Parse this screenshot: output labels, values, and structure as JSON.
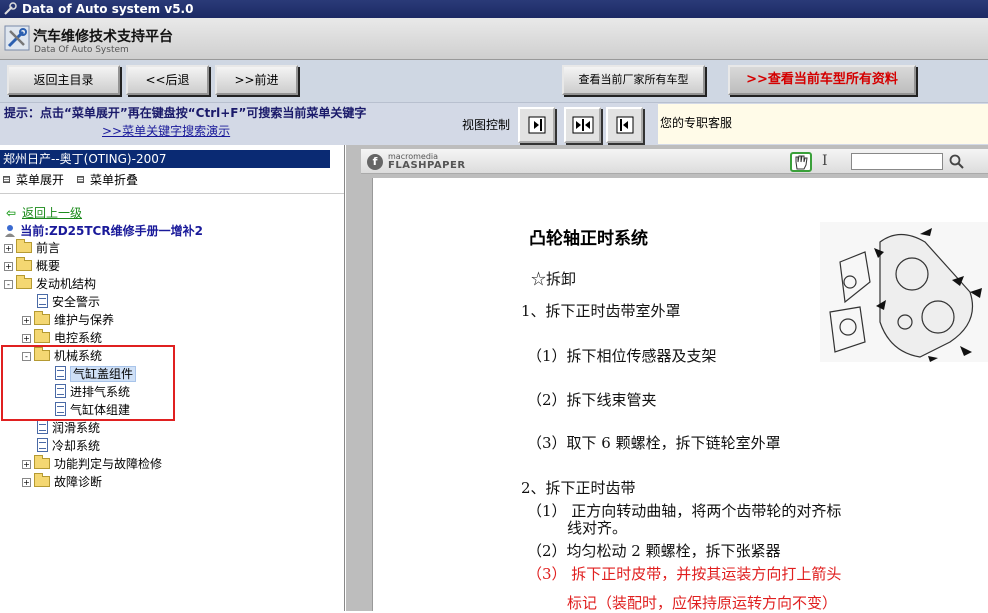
{
  "window": {
    "title": "Data of Auto system v5.0"
  },
  "header": {
    "app_name": "汽车维修技术支持平台",
    "app_subtitle": "Data Of Auto System"
  },
  "toolbar": {
    "home": "返回主目录",
    "back": "<<后退",
    "forward": ">>前进",
    "all_models_maker": "查看当前厂家所有车型",
    "all_docs_model": "查看当前车型所有资料"
  },
  "hint": {
    "text": "提示：点击“菜单展开”再在键盘按“Ctrl+F”可搜索当前菜单关键字",
    "link": ">>菜单关键字搜索演示"
  },
  "view_control": {
    "label": "视图控制"
  },
  "service": {
    "text": "您的专职客服"
  },
  "sidebar": {
    "vehicle": "郑州日产--奥丁(OTING)-2007",
    "expand": "菜单展开",
    "collapse": "菜单折叠",
    "back_up": "返回上一级",
    "current": "当前:ZD25TCR维修手册一增补2",
    "tree": [
      {
        "label": "前言",
        "type": "folder",
        "state": "+"
      },
      {
        "label": "概要",
        "type": "folder",
        "state": "+"
      },
      {
        "label": "发动机结构",
        "type": "folder",
        "state": "-"
      },
      {
        "label": "安全警示",
        "type": "doc"
      },
      {
        "label": "维护与保养",
        "type": "folder",
        "state": "+"
      },
      {
        "label": "电控系统",
        "type": "folder",
        "state": "+"
      },
      {
        "label": "机械系统",
        "type": "folder",
        "state": "-"
      },
      {
        "label": "气缸盖组件",
        "type": "doc",
        "selected": true
      },
      {
        "label": "进排气系统",
        "type": "doc"
      },
      {
        "label": "气缸体组建",
        "type": "doc"
      },
      {
        "label": "润滑系统",
        "type": "doc"
      },
      {
        "label": "冷却系统",
        "type": "doc"
      },
      {
        "label": "功能判定与故障检修",
        "type": "folder",
        "state": "+"
      },
      {
        "label": "故障诊断",
        "type": "folder",
        "state": "+"
      }
    ]
  },
  "viewer": {
    "brand_small": "macromedia",
    "brand_big": "FLASHPAPER",
    "doc": {
      "title": "凸轮轴正时系统",
      "lines": [
        "☆拆卸",
        "1、拆下正时齿带室外罩",
        "（1）拆下相位传感器及支架",
        "（2）拆下线束管夹",
        "（3）取下 6 颗螺栓，拆下链轮室外罩",
        "2、拆下正时齿带",
        "（1） 正方向转动曲轴，将两个齿带轮的对齐标",
        "线对齐。",
        "（2）均匀松动 2 颗螺栓，拆下张紧器",
        "（3） 拆下正时皮带，并按其运装方向打上箭头",
        "标记（装配时，应保持原运转方向不变）"
      ]
    }
  },
  "colors": {
    "accent_red": "#e02020",
    "title_blue": "#1c2a64",
    "vehicle_bar": "#0a2a73"
  }
}
